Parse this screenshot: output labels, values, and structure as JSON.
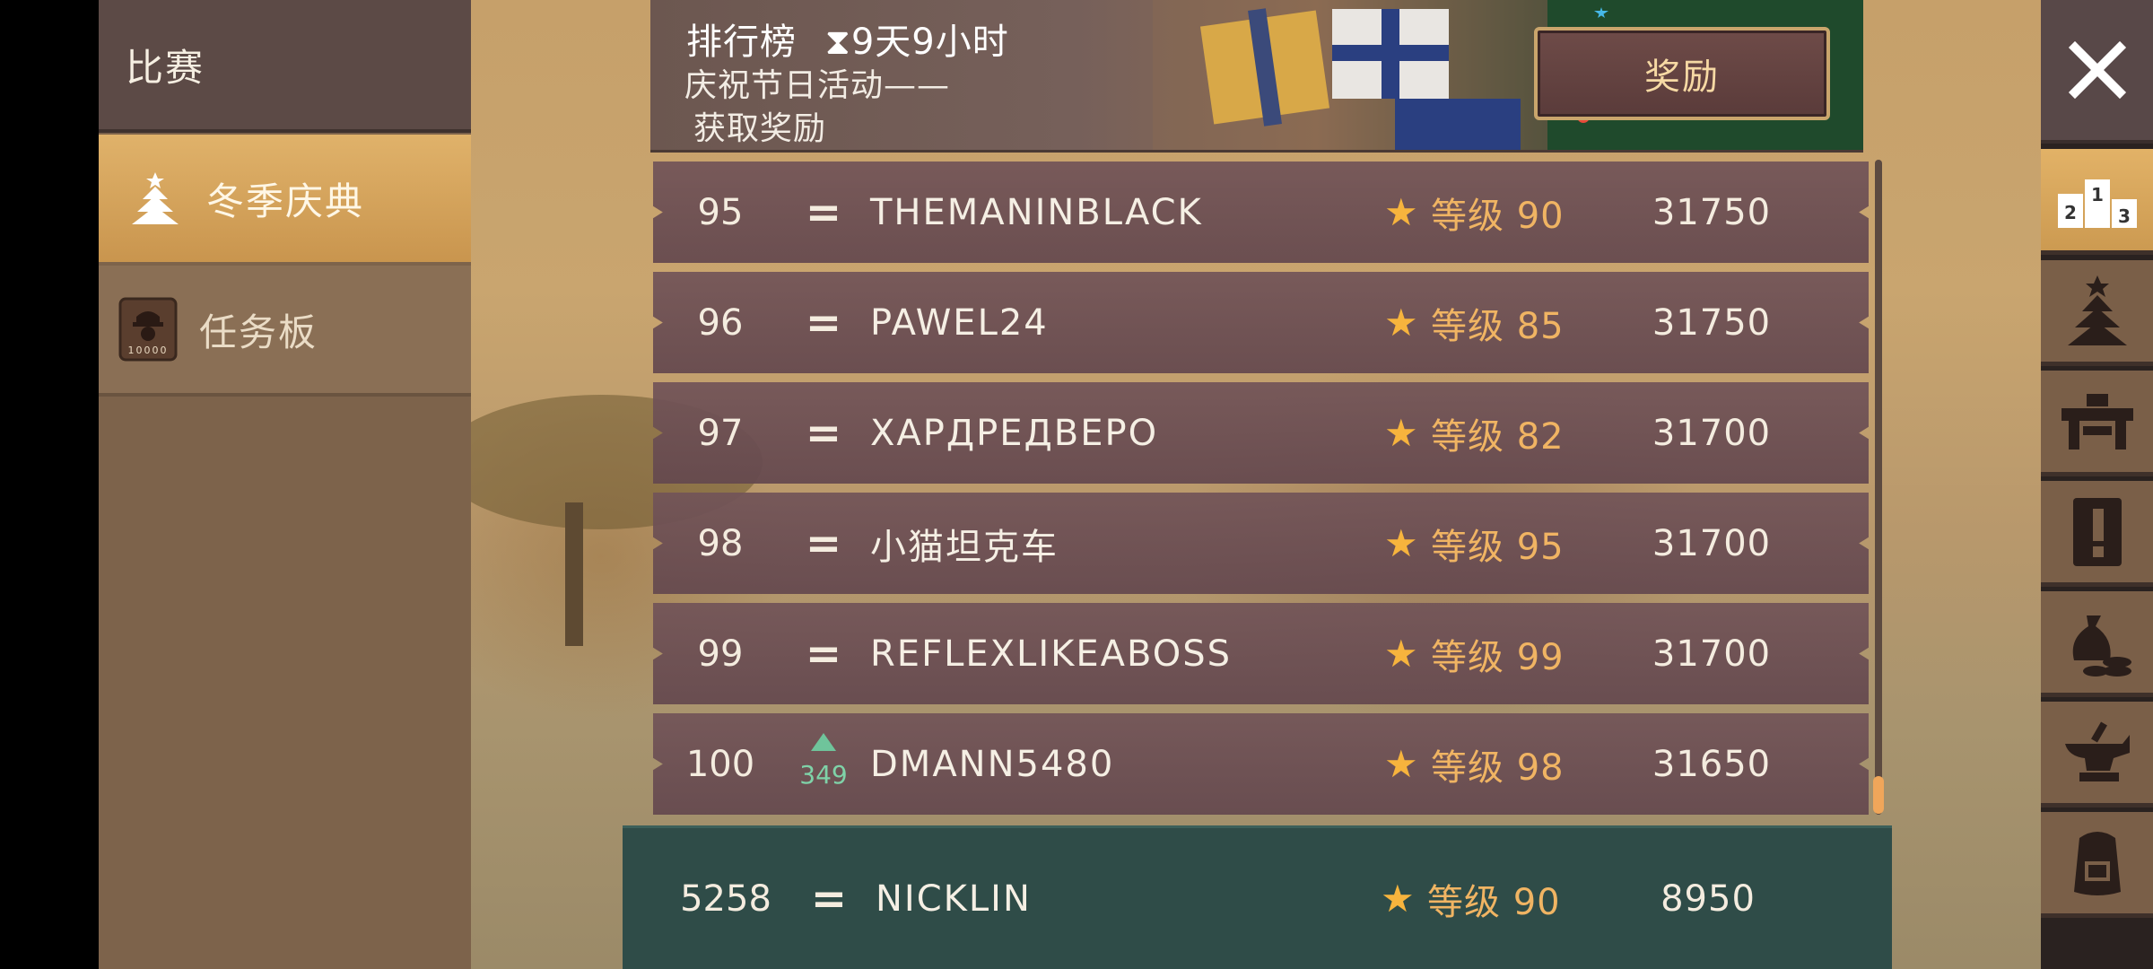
{
  "left_menu": {
    "items": [
      {
        "label": "比赛"
      },
      {
        "label": "冬季庆典"
      },
      {
        "label": "任务板"
      }
    ],
    "task_icon_text": "10000"
  },
  "banner": {
    "title": "排行榜",
    "timer": "9天9小时",
    "subtitle_line1": "庆祝节日活动——",
    "subtitle_line2": "获取奖励",
    "reward_button": "奖励"
  },
  "leaderboard": {
    "rows": [
      {
        "rank": "95",
        "change": "=",
        "name": "THEMANINBLACK",
        "level_label": "等级",
        "level": "90",
        "score": "31750"
      },
      {
        "rank": "96",
        "change": "=",
        "name": "PAWEL24",
        "level_label": "等级",
        "level": "85",
        "score": "31750"
      },
      {
        "rank": "97",
        "change": "=",
        "name": "ХАРДРЕДВЕРО",
        "level_label": "等级",
        "level": "82",
        "score": "31700"
      },
      {
        "rank": "98",
        "change": "=",
        "name": "小猫坦克车",
        "level_label": "等级",
        "level": "95",
        "score": "31700"
      },
      {
        "rank": "99",
        "change": "=",
        "name": "REFLEXLIKEABOSS",
        "level_label": "等级",
        "level": "99",
        "score": "31700"
      },
      {
        "rank": "100",
        "change": "up",
        "change_value": "349",
        "name": "DMANN5480",
        "level_label": "等级",
        "level": "98",
        "score": "31650"
      }
    ],
    "self": {
      "rank": "5258",
      "change": "=",
      "name": "NICKLIN",
      "level_label": "等级",
      "level": "90",
      "score": "8950"
    }
  },
  "right_bar": {
    "tabs": [
      "close-icon",
      "podium-icon",
      "christmas-tree-icon",
      "workbench-icon",
      "quest-book-icon",
      "money-bag-icon",
      "anvil-icon",
      "backpack-icon"
    ],
    "podium_numbers": [
      "2",
      "1",
      "3"
    ]
  },
  "colors": {
    "row_bg": "#6e5156",
    "self_row_bg": "#2f4c48",
    "level_color": "#f0b463",
    "star_color": "#f7b43d",
    "active_tab": "#d9a85c"
  }
}
